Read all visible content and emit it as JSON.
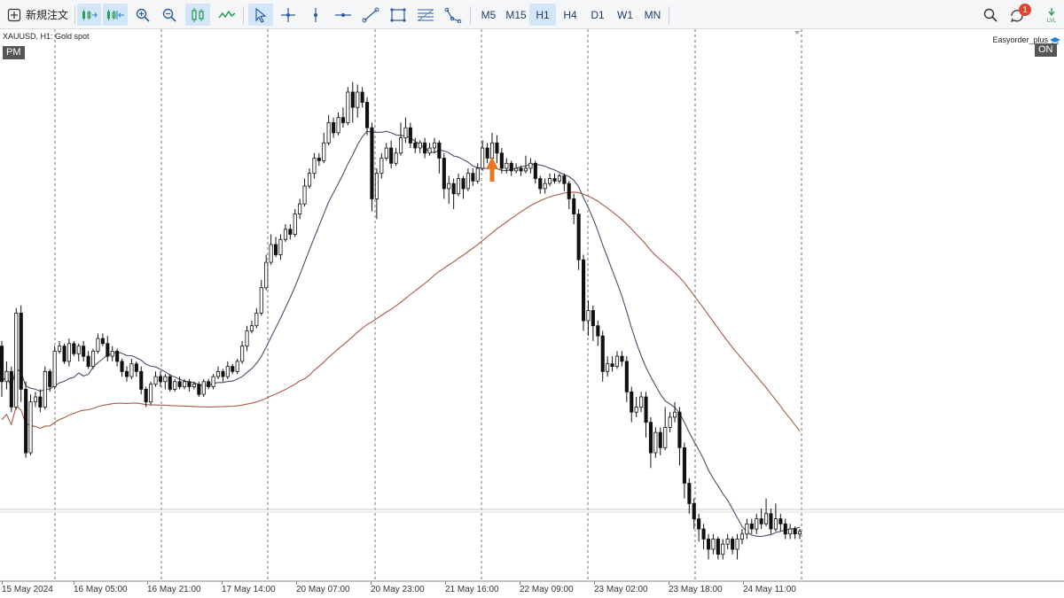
{
  "toolbar": {
    "new_order_label": "新規注文",
    "timeframes": [
      "M5",
      "M15",
      "H1",
      "H4",
      "D1",
      "W1",
      "MN"
    ],
    "active_timeframe": "H1",
    "notification_count": "1",
    "icons": [
      "new-order-icon",
      "autoscroll-icon",
      "chart-shift-icon",
      "zoom-in-icon",
      "zoom-out-icon",
      "candlestick-icon",
      "line-chart-icon",
      "cursor-icon",
      "crosshair-icon",
      "vertical-line-icon",
      "horizontal-line-icon",
      "trendline-icon",
      "rectangle-icon",
      "fibonacci-icon",
      "shapes-icon",
      "search-icon",
      "notifications-icon",
      "level-icon"
    ]
  },
  "chart": {
    "symbol_label": "XAUUSD, H1:  Gold spot",
    "session_tag": "PM",
    "ea_name": "Easyorder_plus",
    "ea_status": "ON",
    "accent_color": "#e87722",
    "short_ma_color": "#4a4e6a",
    "long_ma_color": "#a65a4a"
  },
  "chart_data": {
    "type": "candlestick",
    "x_ticks": [
      "15 May 2024",
      "16 May 05:00",
      "16 May 21:00",
      "17 May 14:00",
      "20 May 07:00",
      "20 May 23:00",
      "21 May 16:00",
      "22 May 09:00",
      "23 May 02:00",
      "23 May 18:00",
      "24 May 11:00"
    ],
    "grid": "vertical dashed",
    "series": [],
    "candles": [
      [
        0.72,
        0.58,
        0.74,
        0.52
      ],
      [
        0.58,
        0.62,
        0.66,
        0.55
      ],
      [
        0.62,
        0.48,
        0.64,
        0.46
      ],
      [
        0.48,
        0.85,
        0.87,
        0.47
      ],
      [
        0.85,
        0.55,
        0.88,
        0.5
      ],
      [
        0.55,
        0.3,
        0.58,
        0.28
      ],
      [
        0.3,
        0.5,
        0.53,
        0.29
      ],
      [
        0.5,
        0.52,
        0.54,
        0.48
      ],
      [
        0.52,
        0.48,
        0.55,
        0.46
      ],
      [
        0.48,
        0.62,
        0.64,
        0.47
      ],
      [
        0.62,
        0.56,
        0.63,
        0.54
      ],
      [
        0.56,
        0.7,
        0.72,
        0.55
      ],
      [
        0.7,
        0.72,
        0.74,
        0.69
      ],
      [
        0.72,
        0.66,
        0.73,
        0.65
      ],
      [
        0.66,
        0.73,
        0.75,
        0.64
      ],
      [
        0.73,
        0.69,
        0.74,
        0.68
      ],
      [
        0.69,
        0.72,
        0.73,
        0.66
      ],
      [
        0.72,
        0.68,
        0.74,
        0.66
      ],
      [
        0.68,
        0.64,
        0.7,
        0.63
      ],
      [
        0.64,
        0.7,
        0.71,
        0.63
      ],
      [
        0.7,
        0.75,
        0.77,
        0.69
      ],
      [
        0.75,
        0.73,
        0.77,
        0.72
      ],
      [
        0.73,
        0.68,
        0.76,
        0.66
      ],
      [
        0.68,
        0.7,
        0.72,
        0.66
      ],
      [
        0.7,
        0.66,
        0.71,
        0.64
      ],
      [
        0.66,
        0.62,
        0.67,
        0.6
      ],
      [
        0.62,
        0.6,
        0.64,
        0.58
      ],
      [
        0.6,
        0.65,
        0.67,
        0.59
      ],
      [
        0.65,
        0.62,
        0.66,
        0.6
      ],
      [
        0.62,
        0.55,
        0.64,
        0.53
      ],
      [
        0.55,
        0.5,
        0.56,
        0.48
      ],
      [
        0.5,
        0.57,
        0.58,
        0.49
      ],
      [
        0.57,
        0.6,
        0.62,
        0.56
      ],
      [
        0.6,
        0.58,
        0.62,
        0.56
      ],
      [
        0.58,
        0.6,
        0.61,
        0.55
      ],
      [
        0.6,
        0.55,
        0.61,
        0.54
      ],
      [
        0.55,
        0.58,
        0.59,
        0.54
      ],
      [
        0.58,
        0.56,
        0.6,
        0.55
      ],
      [
        0.56,
        0.58,
        0.59,
        0.55
      ],
      [
        0.58,
        0.56,
        0.59,
        0.54
      ],
      [
        0.56,
        0.57,
        0.58,
        0.55
      ],
      [
        0.57,
        0.53,
        0.58,
        0.52
      ],
      [
        0.53,
        0.58,
        0.59,
        0.52
      ],
      [
        0.58,
        0.56,
        0.59,
        0.55
      ],
      [
        0.56,
        0.6,
        0.61,
        0.55
      ],
      [
        0.6,
        0.62,
        0.64,
        0.59
      ],
      [
        0.62,
        0.6,
        0.63,
        0.58
      ],
      [
        0.6,
        0.64,
        0.66,
        0.59
      ],
      [
        0.64,
        0.62,
        0.65,
        0.61
      ],
      [
        0.62,
        0.66,
        0.67,
        0.61
      ],
      [
        0.66,
        0.72,
        0.74,
        0.65
      ],
      [
        0.72,
        0.78,
        0.8,
        0.7
      ],
      [
        0.78,
        0.8,
        0.82,
        0.77
      ],
      [
        0.8,
        0.85,
        0.87,
        0.79
      ],
      [
        0.85,
        0.95,
        0.98,
        0.84
      ],
      [
        0.95,
        1.05,
        1.08,
        0.94
      ],
      [
        1.05,
        1.12,
        1.16,
        1.04
      ],
      [
        1.12,
        1.08,
        1.15,
        1.07
      ],
      [
        1.08,
        1.14,
        1.16,
        1.06
      ],
      [
        1.14,
        1.18,
        1.2,
        1.13
      ],
      [
        1.18,
        1.16,
        1.2,
        1.14
      ],
      [
        1.16,
        1.24,
        1.26,
        1.15
      ],
      [
        1.24,
        1.28,
        1.3,
        1.22
      ],
      [
        1.28,
        1.35,
        1.38,
        1.27
      ],
      [
        1.35,
        1.4,
        1.42,
        1.34
      ],
      [
        1.4,
        1.46,
        1.48,
        1.38
      ],
      [
        1.46,
        1.45,
        1.48,
        1.43
      ],
      [
        1.45,
        1.52,
        1.56,
        1.44
      ],
      [
        1.52,
        1.6,
        1.63,
        1.51
      ],
      [
        1.6,
        1.56,
        1.62,
        1.54
      ],
      [
        1.56,
        1.62,
        1.64,
        1.55
      ],
      [
        1.62,
        1.6,
        1.66,
        1.58
      ],
      [
        1.6,
        1.72,
        1.74,
        1.59
      ],
      [
        1.72,
        1.66,
        1.76,
        1.6
      ],
      [
        1.66,
        1.72,
        1.75,
        1.62
      ],
      [
        1.72,
        1.68,
        1.74,
        1.66
      ],
      [
        1.68,
        1.58,
        1.7,
        1.55
      ],
      [
        1.58,
        1.3,
        1.6,
        1.25
      ],
      [
        1.3,
        1.4,
        1.42,
        1.22
      ],
      [
        1.4,
        1.46,
        1.48,
        1.38
      ],
      [
        1.46,
        1.5,
        1.52,
        1.45
      ],
      [
        1.5,
        1.44,
        1.53,
        1.42
      ],
      [
        1.44,
        1.48,
        1.5,
        1.43
      ],
      [
        1.48,
        1.54,
        1.6,
        1.47
      ],
      [
        1.54,
        1.58,
        1.62,
        1.52
      ],
      [
        1.58,
        1.52,
        1.6,
        1.5
      ],
      [
        1.52,
        1.5,
        1.54,
        1.48
      ],
      [
        1.5,
        1.52,
        1.53,
        1.48
      ],
      [
        1.52,
        1.48,
        1.54,
        1.46
      ],
      [
        1.48,
        1.5,
        1.52,
        1.47
      ],
      [
        1.5,
        1.52,
        1.54,
        1.48
      ],
      [
        1.52,
        1.46,
        1.53,
        1.4
      ],
      [
        1.46,
        1.34,
        1.48,
        1.3
      ],
      [
        1.34,
        1.36,
        1.39,
        1.28
      ],
      [
        1.36,
        1.32,
        1.38,
        1.26
      ],
      [
        1.32,
        1.38,
        1.4,
        1.31
      ],
      [
        1.38,
        1.34,
        1.39,
        1.3
      ],
      [
        1.34,
        1.4,
        1.42,
        1.33
      ],
      [
        1.4,
        1.37,
        1.42,
        1.35
      ],
      [
        1.37,
        1.42,
        1.44,
        1.36
      ],
      [
        1.42,
        1.5,
        1.53,
        1.41
      ],
      [
        1.5,
        1.46,
        1.52,
        1.44
      ],
      [
        1.46,
        1.52,
        1.56,
        1.45
      ],
      [
        1.52,
        1.48,
        1.55,
        1.44
      ],
      [
        1.48,
        1.42,
        1.5,
        1.4
      ],
      [
        1.42,
        1.44,
        1.46,
        1.4
      ],
      [
        1.44,
        1.41,
        1.45,
        1.39
      ],
      [
        1.41,
        1.42,
        1.44,
        1.4
      ],
      [
        1.42,
        1.41,
        1.43,
        1.39
      ],
      [
        1.41,
        1.42,
        1.47,
        1.4
      ],
      [
        1.42,
        1.44,
        1.46,
        1.4
      ],
      [
        1.44,
        1.38,
        1.45,
        1.36
      ],
      [
        1.38,
        1.34,
        1.39,
        1.32
      ],
      [
        1.34,
        1.36,
        1.38,
        1.32
      ],
      [
        1.36,
        1.38,
        1.4,
        1.35
      ],
      [
        1.38,
        1.37,
        1.4,
        1.36
      ],
      [
        1.37,
        1.39,
        1.4,
        1.36
      ],
      [
        1.39,
        1.36,
        1.4,
        1.33
      ],
      [
        1.36,
        1.3,
        1.37,
        1.26
      ],
      [
        1.3,
        1.24,
        1.32,
        1.2
      ],
      [
        1.24,
        1.06,
        1.26,
        1.02
      ],
      [
        1.06,
        0.82,
        1.08,
        0.78
      ],
      [
        0.82,
        0.86,
        0.9,
        0.76
      ],
      [
        0.86,
        0.8,
        0.88,
        0.74
      ],
      [
        0.8,
        0.76,
        0.82,
        0.72
      ],
      [
        0.76,
        0.62,
        0.78,
        0.58
      ],
      [
        0.62,
        0.65,
        0.68,
        0.6
      ],
      [
        0.65,
        0.64,
        0.68,
        0.62
      ],
      [
        0.64,
        0.68,
        0.7,
        0.63
      ],
      [
        0.68,
        0.66,
        0.7,
        0.64
      ],
      [
        0.66,
        0.54,
        0.68,
        0.5
      ],
      [
        0.54,
        0.46,
        0.56,
        0.42
      ],
      [
        0.46,
        0.48,
        0.52,
        0.44
      ],
      [
        0.48,
        0.52,
        0.54,
        0.46
      ],
      [
        0.52,
        0.42,
        0.54,
        0.36
      ],
      [
        0.42,
        0.3,
        0.44,
        0.24
      ],
      [
        0.3,
        0.38,
        0.4,
        0.28
      ],
      [
        0.38,
        0.32,
        0.4,
        0.29
      ],
      [
        0.32,
        0.4,
        0.48,
        0.31
      ],
      [
        0.4,
        0.44,
        0.46,
        0.38
      ],
      [
        0.44,
        0.46,
        0.5,
        0.42
      ],
      [
        0.46,
        0.32,
        0.48,
        0.25
      ],
      [
        0.32,
        0.18,
        0.34,
        0.12
      ],
      [
        0.18,
        0.1,
        0.2,
        0.06
      ],
      [
        0.1,
        0.04,
        0.12,
        0.0
      ],
      [
        0.04,
        0.0,
        0.06,
        -0.05
      ],
      [
        0.0,
        -0.04,
        0.02,
        -0.08
      ],
      [
        -0.04,
        -0.08,
        -0.02,
        -0.12
      ],
      [
        -0.08,
        -0.04,
        -0.02,
        -0.1
      ],
      [
        -0.04,
        -0.1,
        -0.03,
        -0.12
      ],
      [
        -0.1,
        -0.06,
        -0.04,
        -0.12
      ],
      [
        -0.06,
        -0.04,
        -0.02,
        -0.08
      ],
      [
        -0.04,
        -0.08,
        -0.03,
        -0.1
      ],
      [
        -0.08,
        -0.04,
        -0.02,
        -0.12
      ],
      [
        -0.04,
        -0.02,
        0.0,
        -0.06
      ],
      [
        -0.02,
        0.02,
        0.04,
        -0.04
      ],
      [
        0.02,
        0.0,
        0.04,
        -0.02
      ],
      [
        0.0,
        0.04,
        0.06,
        -0.02
      ],
      [
        0.04,
        0.02,
        0.08,
        0.0
      ],
      [
        0.02,
        0.06,
        0.12,
        0.01
      ],
      [
        0.06,
        0.0,
        0.08,
        -0.02
      ],
      [
        0.0,
        0.04,
        0.1,
        -0.01
      ],
      [
        0.04,
        0.02,
        0.06,
        -0.01
      ],
      [
        0.02,
        -0.02,
        0.04,
        -0.04
      ],
      [
        -0.02,
        0.0,
        0.02,
        -0.04
      ],
      [
        0.0,
        -0.02,
        0.01,
        -0.04
      ],
      [
        -0.02,
        -0.01,
        0.0,
        -0.04
      ]
    ]
  }
}
